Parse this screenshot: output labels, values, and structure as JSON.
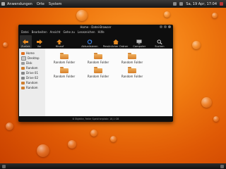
{
  "top_panel": {
    "menus": [
      "Anwendungen",
      "Orte",
      "System"
    ],
    "clock": "Sa, 19 Apr, 17:04"
  },
  "window": {
    "title": "Home - Datei-Browser",
    "menu": [
      "Datei",
      "Bearbeiten",
      "Ansicht",
      "Gehe zu",
      "Lesezeichen",
      "Hilfe"
    ],
    "toolbar": [
      {
        "label": "Zurück",
        "icon": "back-arrow-icon"
      },
      {
        "label": "Vor",
        "icon": "forward-arrow-icon"
      },
      {
        "label": "Hinauf",
        "icon": "up-arrow-icon"
      },
      {
        "label": "Aktualisieren",
        "icon": "refresh-icon"
      },
      {
        "label": "Persönlicher Ordner",
        "icon": "home-icon"
      },
      {
        "label": "Computer",
        "icon": "computer-icon"
      },
      {
        "label": "Suchen",
        "icon": "search-icon"
      }
    ],
    "sidebar": [
      {
        "label": "Home",
        "color": "#e07020"
      },
      {
        "label": "Desktop",
        "color": "#c8c8c8"
      },
      {
        "label": "Disk",
        "color": "#9a9a9a"
      },
      {
        "label": "Random",
        "color": "#d08030"
      },
      {
        "label": "Drive 01",
        "color": "#888888"
      },
      {
        "label": "Drive 02",
        "color": "#888888"
      },
      {
        "label": "Random",
        "color": "#d08030"
      },
      {
        "label": "Random",
        "color": "#d08030"
      }
    ],
    "folders": [
      "Random Folder",
      "Random Folder",
      "Random Folder",
      "Random Folder",
      "Random Folder",
      "Random Folder"
    ],
    "status": "6 Objekte, freier Speicherplatz: 18,1 GB"
  }
}
